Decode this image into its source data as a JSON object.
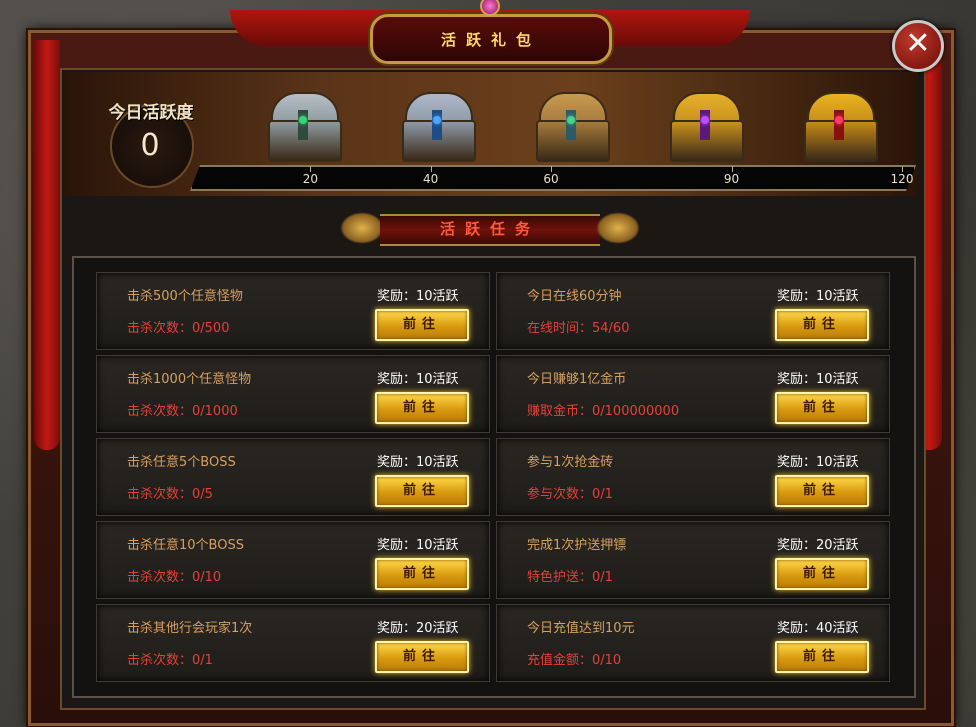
{
  "title": "活跃礼包",
  "close_label": "✕",
  "activity": {
    "label": "今日活跃度",
    "value": "0",
    "max": 120,
    "current": 0,
    "milestones": [
      "20",
      "40",
      "60",
      "90",
      "120"
    ]
  },
  "chests": [
    {
      "name": "silver-chest",
      "body": "#8f9aa0",
      "lid": "#b4bec4",
      "band": "#2e4a3a",
      "gem": "#3ad27a"
    },
    {
      "name": "blue-silver-chest",
      "body": "#8e99a8",
      "lid": "#aeb8c8",
      "band": "#1d4c86",
      "gem": "#4ea4ff"
    },
    {
      "name": "bronze-chest",
      "body": "#a57a3c",
      "lid": "#c89a52",
      "band": "#2c5a66",
      "gem": "#49d08a"
    },
    {
      "name": "purple-gold-chest",
      "body": "#c8901e",
      "lid": "#e6b02a",
      "band": "#5a1a7a",
      "gem": "#c04aff"
    },
    {
      "name": "red-gold-chest",
      "body": "#c68a18",
      "lid": "#e8b420",
      "band": "#8a1010",
      "gem": "#ff3a6a"
    }
  ],
  "section_title": "活跃任务",
  "go_label": "前往",
  "tasks": [
    {
      "name": "击杀500个任意怪物",
      "progress": "击杀次数：0/500",
      "reward": "奖励：10活跃"
    },
    {
      "name": "今日在线60分钟",
      "progress": "在线时间：54/60",
      "reward": "奖励：10活跃"
    },
    {
      "name": "击杀1000个任意怪物",
      "progress": "击杀次数：0/1000",
      "reward": "奖励：10活跃"
    },
    {
      "name": "今日赚够1亿金币",
      "progress": "赚取金币：0/100000000",
      "reward": "奖励：10活跃"
    },
    {
      "name": "击杀任意5个BOSS",
      "progress": "击杀次数：0/5",
      "reward": "奖励：10活跃"
    },
    {
      "name": "参与1次抢金砖",
      "progress": "参与次数：0/1",
      "reward": "奖励：10活跃"
    },
    {
      "name": "击杀任意10个BOSS",
      "progress": "击杀次数：0/10",
      "reward": "奖励：10活跃"
    },
    {
      "name": "完成1次护送押镖",
      "progress": "特色护送：0/1",
      "reward": "奖励：20活跃"
    },
    {
      "name": "击杀其他行会玩家1次",
      "progress": "击杀次数：0/1",
      "reward": "奖励：20活跃"
    },
    {
      "name": "今日充值达到10元",
      "progress": "充值金额：0/10",
      "reward": "奖励：40活跃"
    }
  ]
}
